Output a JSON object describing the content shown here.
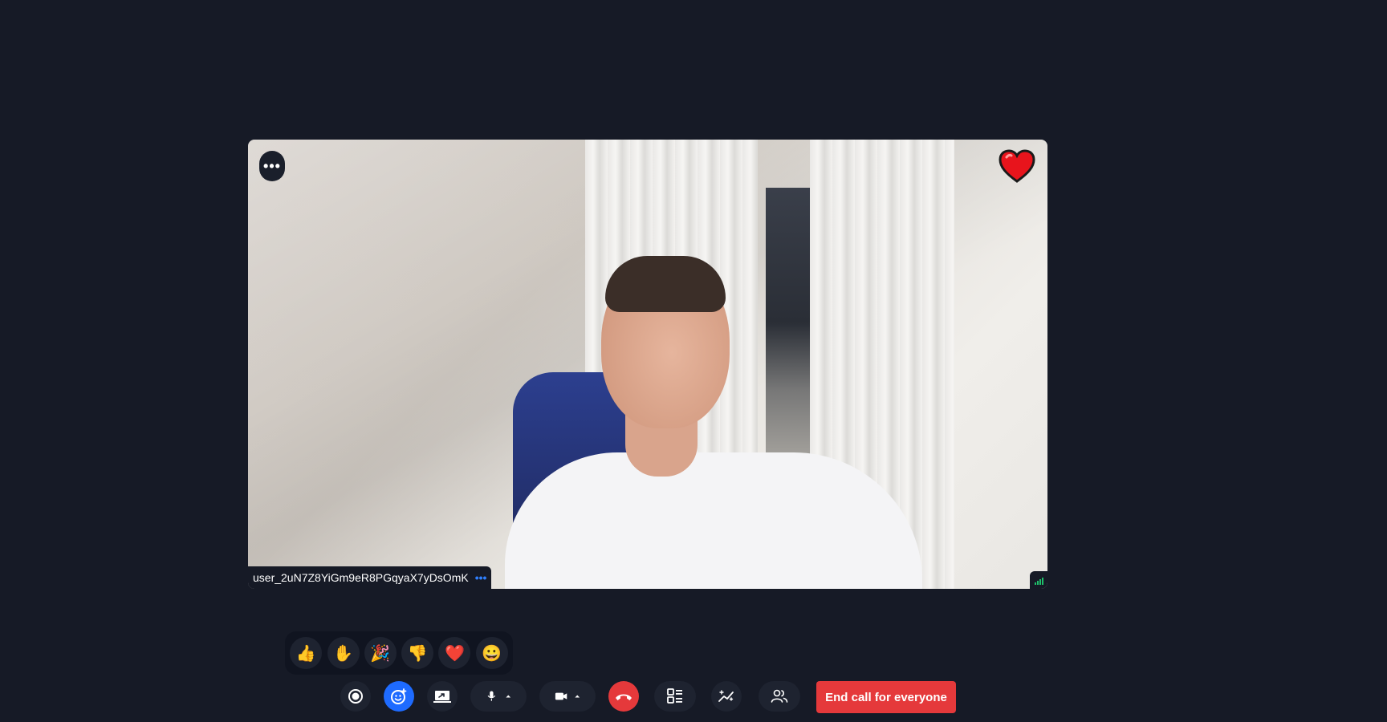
{
  "participant": {
    "name": "user_2uN7Z8YiGm9eR8PGqyaX7yDsOmK",
    "menu_label": "•••",
    "name_menu": "•••",
    "reaction_icon": "heart-icon"
  },
  "reactions": [
    {
      "icon": "thumbs-up-icon",
      "glyph": "👍"
    },
    {
      "icon": "raised-hand-icon",
      "glyph": "✋"
    },
    {
      "icon": "party-popper-icon",
      "glyph": "🎉"
    },
    {
      "icon": "thumbs-down-icon",
      "glyph": "👎"
    },
    {
      "icon": "heart-icon",
      "glyph": "❤️"
    },
    {
      "icon": "grinning-face-icon",
      "glyph": "😀"
    }
  ],
  "controls": {
    "end_call_everyone_label": "End call for everyone"
  },
  "colors": {
    "background": "#161a26",
    "accent_blue": "#2f80ff",
    "danger_red": "#e5393b"
  }
}
